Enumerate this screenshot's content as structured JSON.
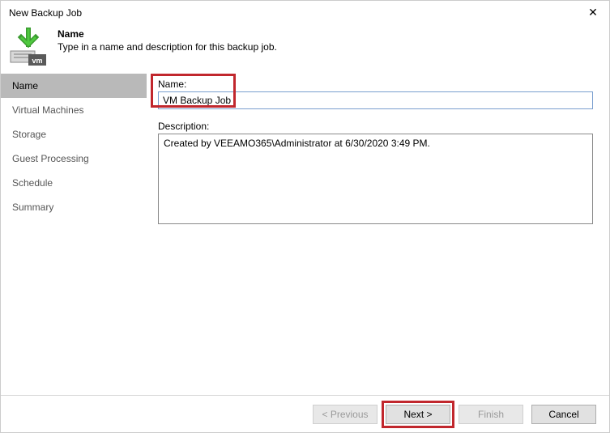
{
  "window": {
    "title": "New Backup Job",
    "close_icon": "✕"
  },
  "header": {
    "title": "Name",
    "subtitle": "Type in a name and description for this backup job."
  },
  "sidebar": {
    "items": [
      {
        "label": "Name",
        "active": true
      },
      {
        "label": "Virtual Machines",
        "active": false
      },
      {
        "label": "Storage",
        "active": false
      },
      {
        "label": "Guest Processing",
        "active": false
      },
      {
        "label": "Schedule",
        "active": false
      },
      {
        "label": "Summary",
        "active": false
      }
    ]
  },
  "form": {
    "name_label": "Name:",
    "name_value": "VM Backup Job",
    "description_label": "Description:",
    "description_value": "Created by VEEAMO365\\Administrator at 6/30/2020 3:49 PM."
  },
  "footer": {
    "previous": "< Previous",
    "next": "Next >",
    "finish": "Finish",
    "cancel": "Cancel"
  },
  "highlight_color": "#c1272d"
}
